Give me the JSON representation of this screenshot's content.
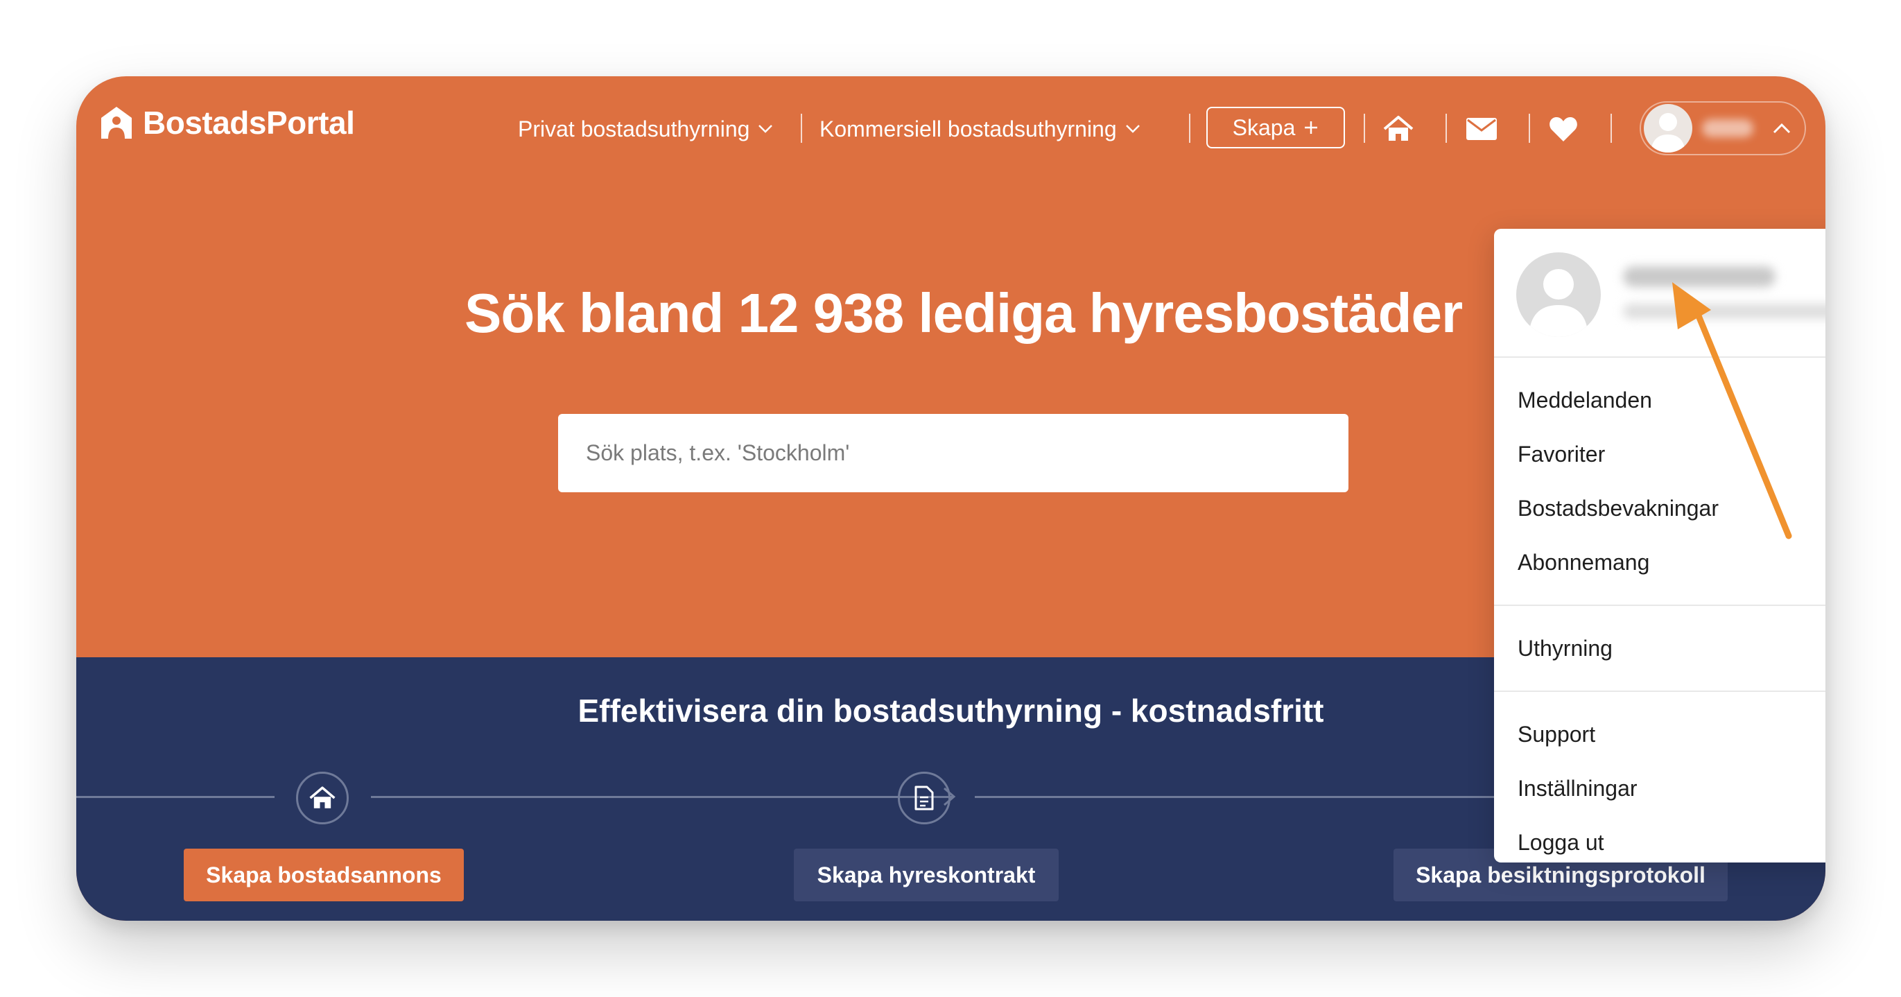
{
  "brand": {
    "name": "BostadsPortal",
    "accent": "#dd7040",
    "dark": "#283660"
  },
  "nav": {
    "private_label": "Privat bostadsuthyrning",
    "commercial_label": "Kommersiell bostadsuthyrning",
    "create_label": "Skapa",
    "create_icon": "plus-icon",
    "home_icon": "home-icon",
    "mail_icon": "mail-icon",
    "favorites_icon": "heart-icon",
    "user_icon": "user-avatar",
    "user_chevron": "chevron-up-icon"
  },
  "hero": {
    "title": "Sök bland 12 938 lediga hyresbostäder",
    "search_placeholder": "Sök plats, t.ex. 'Stockholm'"
  },
  "section": {
    "title": "Effektivisera din bostadsuthyrning - kostnadsfritt",
    "steps": [
      {
        "label": "Skapa bostadsannons",
        "icon": "home-icon",
        "primary": true
      },
      {
        "label": "Skapa hyreskontrakt",
        "icon": "document-icon",
        "primary": false
      },
      {
        "label": "Skapa besiktningsprotokoll",
        "icon": "swap-icon",
        "primary": false
      }
    ]
  },
  "menu": {
    "group1": [
      "Meddelanden",
      "Favoriter",
      "Bostadsbevakningar",
      "Abonnemang"
    ],
    "group2": {
      "label": "Uthyrning",
      "icon": "arrow-right-icon"
    },
    "group3": [
      "Support",
      "Inställningar",
      "Logga ut"
    ]
  },
  "annotation": {
    "color": "#f0922e"
  }
}
